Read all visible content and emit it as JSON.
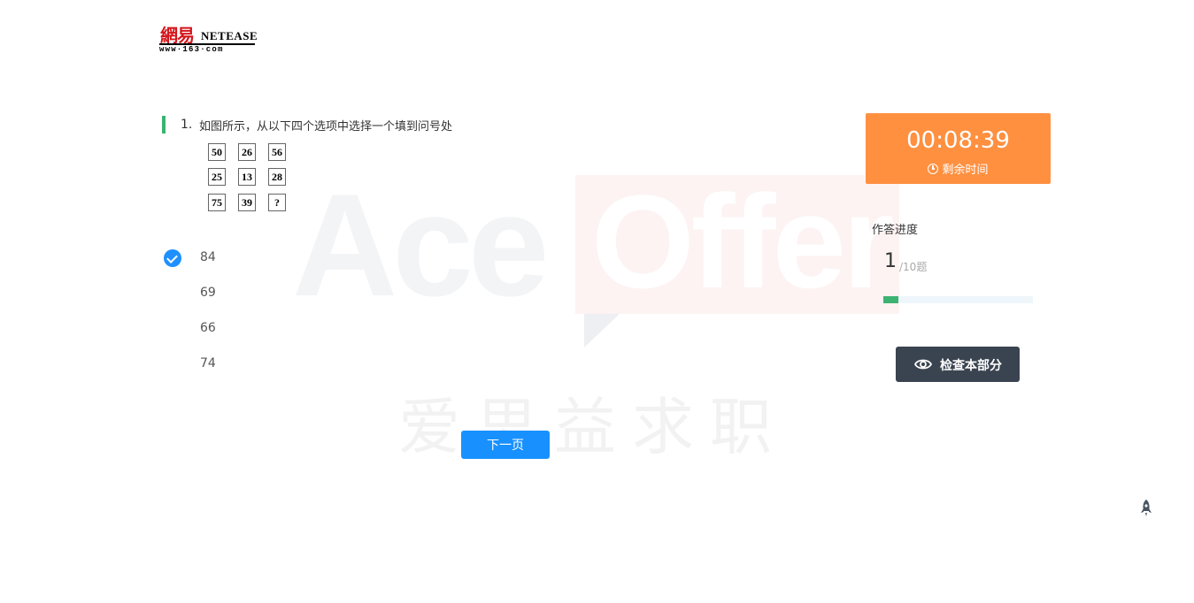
{
  "logo": {
    "cn_text": "網易",
    "en_text": "NETEASE",
    "url_text": "www·163·com"
  },
  "watermark": {
    "brand_left": "Ace",
    "brand_right": "Offer",
    "cn_text": "爱思益求职"
  },
  "question": {
    "number": "1.",
    "text": "如图所示，从以下四个选项中选择一个填到问号处",
    "grid": [
      [
        "50",
        "26",
        "56"
      ],
      [
        "25",
        "13",
        "28"
      ],
      [
        "75",
        "39",
        "?"
      ]
    ]
  },
  "options": [
    {
      "label": "84",
      "selected": true
    },
    {
      "label": "69",
      "selected": false
    },
    {
      "label": "66",
      "selected": false
    },
    {
      "label": "74",
      "selected": false
    }
  ],
  "next_button": "下一页",
  "timer": {
    "time": "00:08:39",
    "label": "剩余时间",
    "color": "#ff9040"
  },
  "progress": {
    "title": "作答进度",
    "current": "1",
    "total": "/10题",
    "fraction": 0.1,
    "color": "#3cb371"
  },
  "check_button": "检查本部分",
  "icons": {
    "timer": "clock-icon",
    "check": "eye-icon",
    "float": "rocket-icon"
  }
}
